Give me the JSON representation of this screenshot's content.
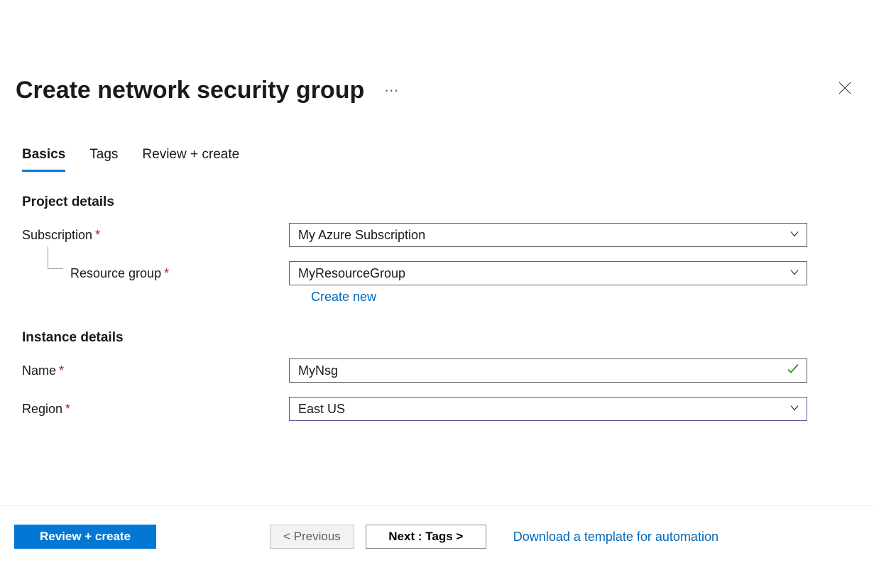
{
  "header": {
    "title": "Create network security group"
  },
  "tabs": {
    "basics": "Basics",
    "tags": "Tags",
    "review": "Review + create"
  },
  "sections": {
    "project": "Project details",
    "instance": "Instance details"
  },
  "labels": {
    "subscription": "Subscription",
    "resource_group": "Resource group",
    "name": "Name",
    "region": "Region"
  },
  "values": {
    "subscription": "My Azure Subscription",
    "resource_group": "MyResourceGroup",
    "name": "MyNsg",
    "region": "East US"
  },
  "links": {
    "create_new": "Create new",
    "download_template": "Download a template for automation"
  },
  "buttons": {
    "review_create": "Review + create",
    "previous": "< Previous",
    "next": "Next : Tags >"
  }
}
